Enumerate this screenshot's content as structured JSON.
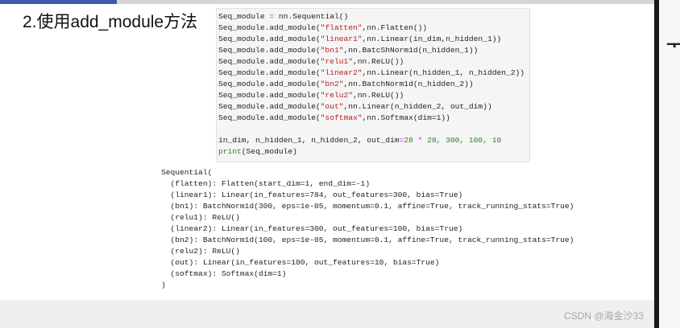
{
  "heading": "2.使用add_module方法",
  "code": {
    "l1": {
      "a": "Seq_module ",
      "b": "=",
      "c": " nn.Sequential()"
    },
    "l2": {
      "a": "Seq_module.add_module(",
      "s": "\"flatten\"",
      "b": ",nn.Flatten())"
    },
    "l3": {
      "a": "Seq_module.add_module(",
      "s": "\"linear1\"",
      "b": ",nn.Linear(in_dim,n_hidden_1))"
    },
    "l4": {
      "a": "Seq_module.add_module(",
      "s": "\"bn1\"",
      "b": ",nn.BatcShNorm1d(n_hidden_1))"
    },
    "l5": {
      "a": "Seq_module.add_module(",
      "s": "\"relu1\"",
      "b": ",nn.ReLU())"
    },
    "l6": {
      "a": "Seq_module.add_module(",
      "s": "\"linear2\"",
      "b": ",nn.Linear(n_hidden_1, n_hidden_2))"
    },
    "l7": {
      "a": "Seq_module.add_module(",
      "s": "\"bn2\"",
      "b": ",nn.BatchNorm1d(n_hidden_2))"
    },
    "l8": {
      "a": "Seq_module.add_module(",
      "s": "\"relu2\"",
      "b": ",nn.ReLU())"
    },
    "l9": {
      "a": "Seq_module.add_module(",
      "s": "\"out\"",
      "b": ",nn.Linear(n_hidden_2, out_dim))"
    },
    "l10": {
      "a": "Seq_module.add_module(",
      "s": "\"softmax\"",
      "b": ",nn.Softmax(dim=1))"
    },
    "l11": {
      "a": "in_dim, n_hidden_1, n_hidden_2, out_dim",
      "eq": "=",
      "n1": "28",
      "op": " * ",
      "rest": "28, 300, 100, 10"
    },
    "l12": {
      "fn": "print",
      "b": "(Seq_module)"
    }
  },
  "output": [
    "Sequential(",
    "  (flatten): Flatten(start_dim=1, end_dim=-1)",
    "  (linear1): Linear(in_features=784, out_features=300, bias=True)",
    "  (bn1): BatchNorm1d(300, eps=1e-05, momentum=0.1, affine=True, track_running_stats=True)",
    "  (relu1): ReLU()",
    "  (linear2): Linear(in_features=300, out_features=100, bias=True)",
    "  (bn2): BatchNorm1d(100, eps=1e-05, momentum=0.1, affine=True, track_running_stats=True)",
    "  (relu2): ReLU()",
    "  (out): Linear(in_features=100, out_features=10, bias=True)",
    "  (softmax): Softmax(dim=1)",
    ")"
  ],
  "right_glyph": "ᅲ",
  "watermark": "CSDN @海金沙33",
  "colors": {
    "accent": "#3f5aa8",
    "string": "#b22020",
    "keyword": "#2e7d32"
  }
}
